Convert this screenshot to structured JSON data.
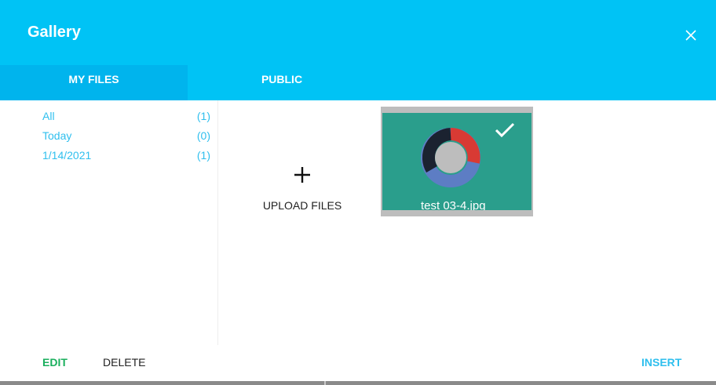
{
  "dialog": {
    "title": "Gallery",
    "close_icon": "close-icon"
  },
  "tabs": [
    {
      "label": "MY FILES",
      "active": true
    },
    {
      "label": "PUBLIC",
      "active": false
    }
  ],
  "filters": [
    {
      "label": "All",
      "count": "(1)"
    },
    {
      "label": "Today",
      "count": "(0)"
    },
    {
      "label": "1/14/2021",
      "count": "(1)"
    }
  ],
  "upload": {
    "icon": "plus-icon",
    "label": "UPLOAD FILES"
  },
  "files": [
    {
      "name": "test 03-4.jpg",
      "selected": true
    }
  ],
  "footer": {
    "edit_label": "EDIT",
    "delete_label": "DELETE",
    "insert_label": "INSERT"
  },
  "colors": {
    "header": "#00c3f5",
    "accent": "#2fbfee",
    "edit": "#1aaf5d"
  }
}
